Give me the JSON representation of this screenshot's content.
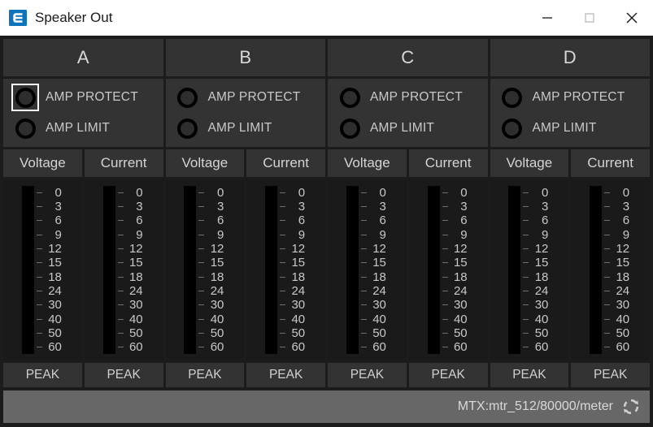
{
  "window": {
    "title": "Speaker Out",
    "logo_icon": "e-logo-icon",
    "minimize_icon": "minimize-icon",
    "maximize_icon": "maximize-icon",
    "close_icon": "close-icon",
    "titlebar_bg": "#ffffff",
    "body_bg": "#1c1c1c"
  },
  "colors": {
    "panel": "#333333",
    "meter_bg": "#1a1a1a",
    "meter_bar": "#000000",
    "text": "#d0d0d0",
    "statusbar_bg": "#676767",
    "focus_outline": "#ffffff"
  },
  "channels": [
    {
      "name": "A",
      "indicators": [
        {
          "label": "AMP PROTECT",
          "state": "off",
          "focused": true
        },
        {
          "label": "AMP LIMIT",
          "state": "off",
          "focused": false
        }
      ],
      "meters": [
        {
          "title": "Voltage",
          "level": 0,
          "peak_label": "PEAK"
        },
        {
          "title": "Current",
          "level": 0,
          "peak_label": "PEAK"
        }
      ]
    },
    {
      "name": "B",
      "indicators": [
        {
          "label": "AMP PROTECT",
          "state": "off",
          "focused": false
        },
        {
          "label": "AMP LIMIT",
          "state": "off",
          "focused": false
        }
      ],
      "meters": [
        {
          "title": "Voltage",
          "level": 0,
          "peak_label": "PEAK"
        },
        {
          "title": "Current",
          "level": 0,
          "peak_label": "PEAK"
        }
      ]
    },
    {
      "name": "C",
      "indicators": [
        {
          "label": "AMP PROTECT",
          "state": "off",
          "focused": false
        },
        {
          "label": "AMP LIMIT",
          "state": "off",
          "focused": false
        }
      ],
      "meters": [
        {
          "title": "Voltage",
          "level": 0,
          "peak_label": "PEAK"
        },
        {
          "title": "Current",
          "level": 0,
          "peak_label": "PEAK"
        }
      ]
    },
    {
      "name": "D",
      "indicators": [
        {
          "label": "AMP PROTECT",
          "state": "off",
          "focused": false
        },
        {
          "label": "AMP LIMIT",
          "state": "off",
          "focused": false
        }
      ],
      "meters": [
        {
          "title": "Voltage",
          "level": 0,
          "peak_label": "PEAK"
        },
        {
          "title": "Current",
          "level": 0,
          "peak_label": "PEAK"
        }
      ]
    }
  ],
  "meter_scale": [
    "0",
    "3",
    "6",
    "9",
    "12",
    "15",
    "18",
    "24",
    "30",
    "40",
    "50",
    "60"
  ],
  "statusbar": {
    "text": "MTX:mtr_512/80000/meter",
    "refresh_icon": "refresh-sync-icon"
  }
}
